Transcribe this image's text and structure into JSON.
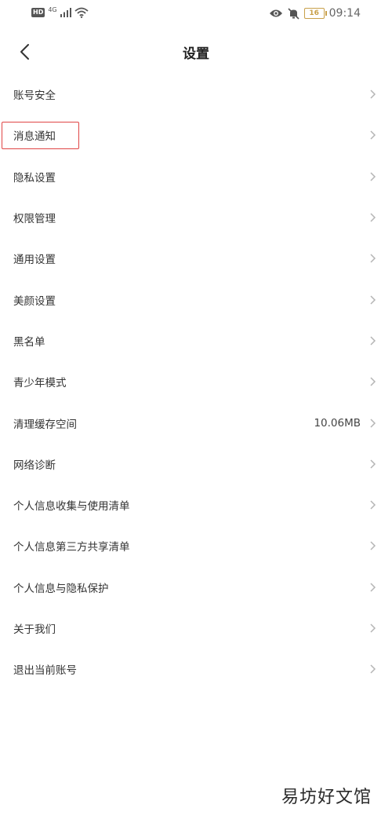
{
  "status_bar": {
    "hd_badge": "HD",
    "network_type": "4G",
    "time": "09:14",
    "battery_level": "16",
    "icons": [
      "signal-icon",
      "wifi-icon",
      "eye-icon",
      "bell-mute-icon",
      "battery-icon"
    ]
  },
  "nav": {
    "back_icon": "chevron-left-icon",
    "title": "设置"
  },
  "settings": {
    "items": [
      {
        "label": "账号安全",
        "value": ""
      },
      {
        "label": "消息通知",
        "value": ""
      },
      {
        "label": "隐私设置",
        "value": ""
      },
      {
        "label": "权限管理",
        "value": ""
      },
      {
        "label": "通用设置",
        "value": ""
      },
      {
        "label": "美颜设置",
        "value": ""
      },
      {
        "label": "黑名单",
        "value": ""
      },
      {
        "label": "青少年模式",
        "value": ""
      },
      {
        "label": "清理缓存空间",
        "value": "10.06MB"
      },
      {
        "label": "网络诊断",
        "value": ""
      },
      {
        "label": "个人信息收集与使用清单",
        "value": ""
      },
      {
        "label": "个人信息第三方共享清单",
        "value": ""
      },
      {
        "label": "个人信息与隐私保护",
        "value": ""
      },
      {
        "label": "关于我们",
        "value": ""
      },
      {
        "label": "退出当前账号",
        "value": ""
      }
    ]
  },
  "highlight": {
    "target": "消息通知",
    "color": "#e04545"
  },
  "watermark": "易坊好文馆"
}
